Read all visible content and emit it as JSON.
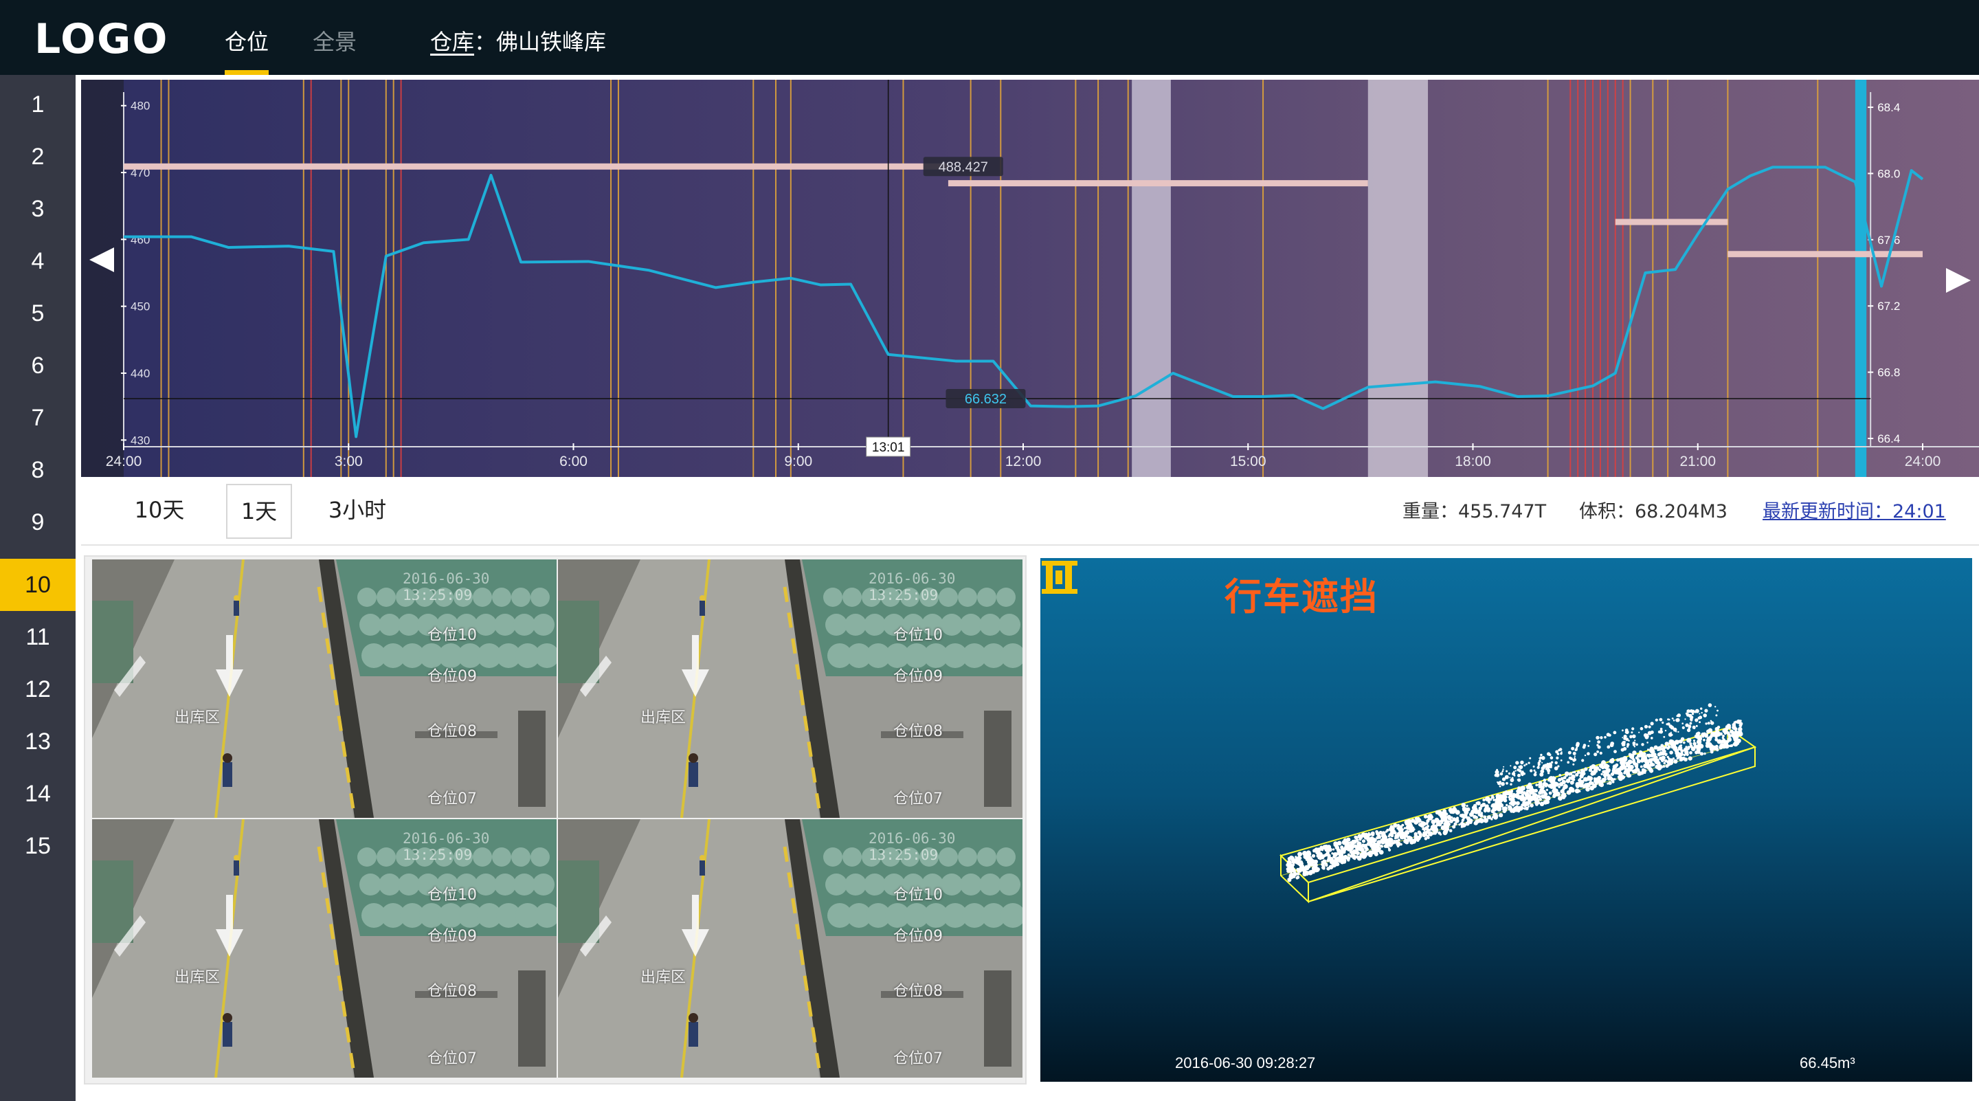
{
  "app": {
    "logo": "LOGO"
  },
  "nav": {
    "tabs": [
      {
        "label": "仓位",
        "active": true
      },
      {
        "label": "全景",
        "active": false
      }
    ],
    "warehouse_label": "仓库",
    "warehouse_sep": "：",
    "warehouse_name": "佛山铁峰库"
  },
  "sidebar": {
    "items": [
      "1",
      "2",
      "3",
      "4",
      "5",
      "6",
      "7",
      "8",
      "9",
      "10",
      "11",
      "12",
      "13",
      "14",
      "15"
    ],
    "active": "10"
  },
  "chart_data": {
    "type": "line",
    "title": "",
    "x_ticks": [
      "24:00",
      "3:00",
      "6:00",
      "9:00",
      "12:00",
      "15:00",
      "18:00",
      "21:00",
      "24:00"
    ],
    "xlim_hours": [
      0,
      24
    ],
    "left_axis": {
      "ticks": [
        "480",
        "470",
        "460",
        "450",
        "440",
        "430"
      ],
      "ylim": [
        429,
        481
      ]
    },
    "right_axis": {
      "ticks": [
        "68.4",
        "68.0",
        "67.6",
        "67.2",
        "66.8",
        "66.4"
      ],
      "ylim": [
        66.35,
        68.45
      ]
    },
    "series": [
      {
        "axis": "left",
        "color": "#1fb0d8",
        "x": [
          0,
          0.9,
          1.4,
          2.2,
          2.8,
          3.1,
          3.5,
          4.0,
          4.6,
          4.9,
          5.3,
          6.2,
          7.0,
          7.9,
          8.4,
          8.9,
          9.3,
          9.7,
          10.2,
          11.1,
          11.6,
          12.1,
          12.6,
          13.0,
          13.5,
          14.0,
          14.8,
          15.2,
          15.6,
          16.0,
          16.6,
          17.5,
          18.1,
          18.6,
          19.0,
          19.6,
          19.9,
          20.3,
          20.7,
          21.0,
          21.4,
          21.7,
          22.0,
          22.3,
          22.7,
          23.1
        ],
        "y": [
          460.4,
          460.4,
          458.8,
          459.0,
          458.2,
          430.5,
          457.5,
          459.5,
          460.0,
          469.6,
          456.6,
          456.7,
          455.4,
          452.8,
          453.6,
          454.2,
          453.2,
          453.3,
          442.8,
          441.8,
          441.8,
          435.1,
          435.0,
          435.1,
          436.6,
          440.0,
          436.5,
          436.5,
          436.7,
          434.7,
          437.9,
          438.7,
          438.0,
          436.5,
          436.6,
          438.1,
          440.0,
          455.0,
          455.5,
          460.8,
          467.5,
          469.5,
          470.8,
          470.8,
          470.8,
          468.6
        ]
      },
      {
        "axis": "left",
        "color": "#1fb0d8",
        "x": [
          23.1,
          23.45,
          23.85,
          24.0
        ],
        "y": [
          468.6,
          453.0,
          470.3,
          469.0
        ]
      }
    ],
    "reference_bars": [
      {
        "x": [
          0,
          11.0
        ],
        "y": 470.9,
        "color": "#e7c4c3"
      },
      {
        "x": [
          11.0,
          16.6
        ],
        "y": 468.4,
        "color": "#e7c4c3"
      },
      {
        "x": [
          19.9,
          21.4
        ],
        "y": 462.6,
        "color": "#e7c4c3"
      },
      {
        "x": [
          21.4,
          24.0
        ],
        "y": 457.8,
        "color": "#e7c4c3"
      }
    ],
    "annotations": [
      {
        "text": "488.427",
        "x": 11.2,
        "y": 470.9
      },
      {
        "text": "66.632",
        "x": 11.5,
        "y": 436.2
      }
    ],
    "cursor": {
      "label": "13:01",
      "x": 10.2,
      "y_value": 436.2
    },
    "highlight_bands": [
      [
        13.45,
        13.97
      ],
      [
        16.6,
        17.4
      ]
    ],
    "band_colors": [
      "#c4bdd0",
      "#c8bfd0"
    ],
    "current_time_band": {
      "x": [
        23.1,
        23.25
      ],
      "color": "#1fb0d8"
    },
    "event_lines": [
      {
        "x": 0.5,
        "color": "#e0a43a"
      },
      {
        "x": 0.6,
        "color": "#e0a43a"
      },
      {
        "x": 2.4,
        "color": "#e0a43a"
      },
      {
        "x": 2.5,
        "color": "#d94040"
      },
      {
        "x": 2.9,
        "color": "#e0a43a"
      },
      {
        "x": 3.0,
        "color": "#e0a43a"
      },
      {
        "x": 3.5,
        "color": "#e0a43a"
      },
      {
        "x": 3.6,
        "color": "#e0a43a"
      },
      {
        "x": 3.7,
        "color": "#d94040"
      },
      {
        "x": 6.5,
        "color": "#e0a43a"
      },
      {
        "x": 6.6,
        "color": "#e0a43a"
      },
      {
        "x": 8.4,
        "color": "#e0a43a"
      },
      {
        "x": 8.7,
        "color": "#e0a43a"
      },
      {
        "x": 8.9,
        "color": "#e0a43a"
      },
      {
        "x": 10.4,
        "color": "#e0a43a"
      },
      {
        "x": 11.3,
        "color": "#e0a43a"
      },
      {
        "x": 11.7,
        "color": "#e0a43a"
      },
      {
        "x": 12.7,
        "color": "#e0a43a"
      },
      {
        "x": 13.0,
        "color": "#e0a43a"
      },
      {
        "x": 13.4,
        "color": "#e0a43a"
      },
      {
        "x": 15.2,
        "color": "#e0a43a"
      },
      {
        "x": 19.0,
        "color": "#e0a43a"
      },
      {
        "x": 19.3,
        "color": "#d94040"
      },
      {
        "x": 19.4,
        "color": "#d94040"
      },
      {
        "x": 19.5,
        "color": "#d94040"
      },
      {
        "x": 19.6,
        "color": "#d94040"
      },
      {
        "x": 19.7,
        "color": "#d94040"
      },
      {
        "x": 19.8,
        "color": "#d94040"
      },
      {
        "x": 19.9,
        "color": "#d94040"
      },
      {
        "x": 20.0,
        "color": "#d94040"
      },
      {
        "x": 20.1,
        "color": "#e0a43a"
      },
      {
        "x": 20.4,
        "color": "#e0a43a"
      },
      {
        "x": 20.6,
        "color": "#e0a43a"
      },
      {
        "x": 21.4,
        "color": "#e0a43a"
      },
      {
        "x": 22.6,
        "color": "#e0a43a"
      }
    ]
  },
  "controls": {
    "ranges": [
      {
        "label": "10天",
        "active": false
      },
      {
        "label": "1天",
        "active": true
      },
      {
        "label": "3小时",
        "active": false
      }
    ],
    "weight": "重量：455.747T",
    "volume": "体积：68.204M3",
    "last_update": "最新更新时间：24:01"
  },
  "cameras": {
    "timestamp": "2016-06-30 13:25:09",
    "zone": "出库区",
    "bays": [
      "仓位10",
      "仓位09",
      "仓位08",
      "仓位07"
    ],
    "count": 4
  },
  "pointcloud": {
    "alert": "行车遮挡",
    "timestamp": "2016-06-30 09:28:27",
    "volume": "66.45m³",
    "alert_color": "#ff5f1a",
    "box_color": "#ffff33"
  }
}
